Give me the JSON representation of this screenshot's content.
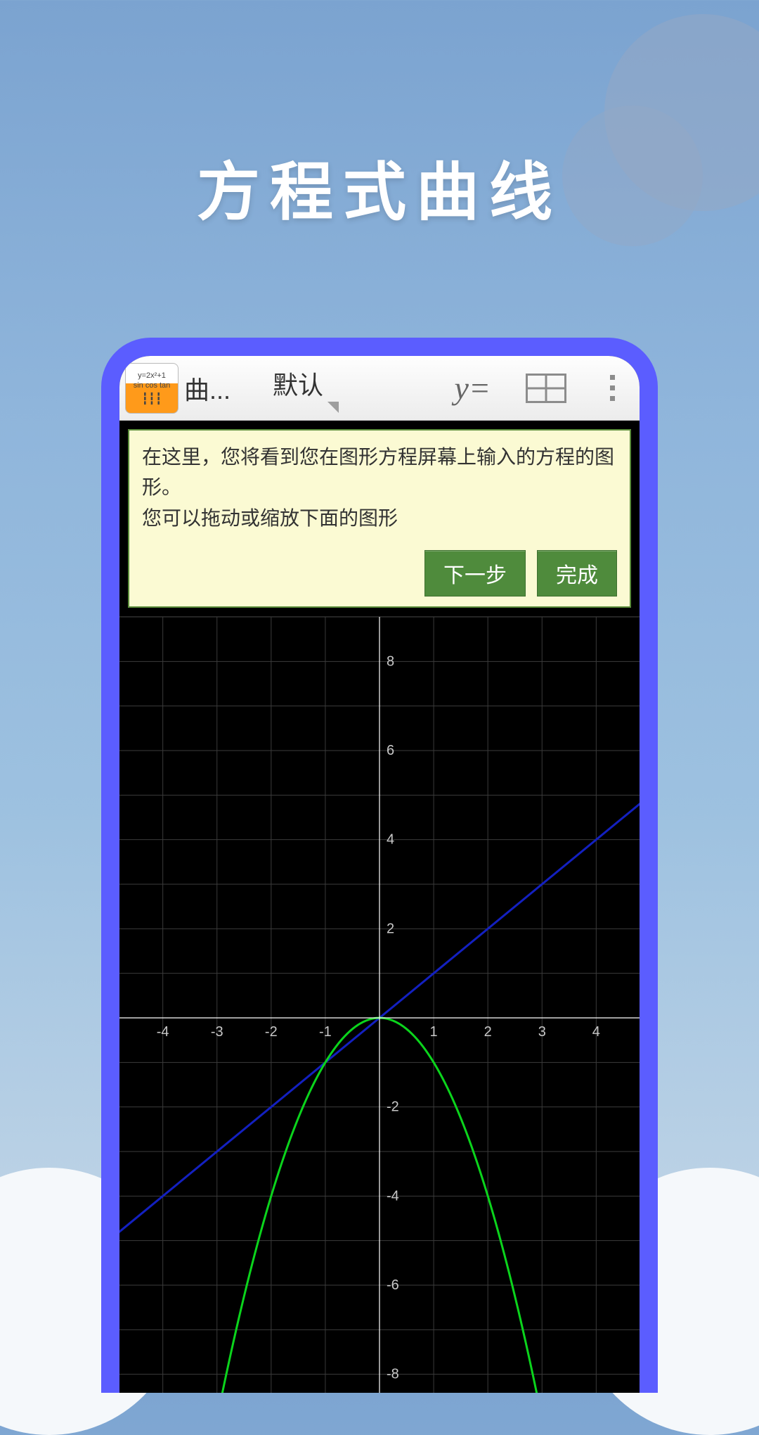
{
  "hero": {
    "title": "方程式曲线"
  },
  "toolbar": {
    "app_icon_top": "y=2x²+1",
    "app_icon_mid": "sin cos tan",
    "title": "曲...",
    "dropdown": "默认",
    "y_equals": "y=",
    "table_icon_name": "table-icon",
    "menu_icon_name": "kebab-menu-icon"
  },
  "hint": {
    "line1": "在这里，您将看到您在图形方程屏幕上输入的方程的图形。",
    "line2": "您可以拖动或缩放下面的图形",
    "next": "下一步",
    "done": "完成"
  },
  "chart_data": {
    "type": "line",
    "xlabel": "",
    "ylabel": "",
    "xlim": [
      -4.8,
      4.8
    ],
    "ylim": [
      -9,
      9
    ],
    "x_ticks": [
      -4,
      -3,
      -2,
      -1,
      1,
      2,
      3,
      4
    ],
    "y_ticks": [
      -8,
      -6,
      -4,
      -2,
      2,
      4,
      6,
      8
    ],
    "series": [
      {
        "name": "line",
        "color": "#1320c0",
        "formula": "y = x",
        "x": [
          -9,
          9
        ],
        "y": [
          -9,
          9
        ]
      },
      {
        "name": "parabola",
        "color": "#0bd41c",
        "formula": "y = -x^2",
        "x": [
          -3,
          -2.5,
          -2,
          -1.5,
          -1,
          -0.5,
          0,
          0.5,
          1,
          1.5,
          2,
          2.5,
          3
        ],
        "y": [
          -9,
          -6.25,
          -4,
          -2.25,
          -1,
          -0.25,
          0,
          -0.25,
          -1,
          -2.25,
          -4,
          -6.25,
          -9
        ]
      }
    ]
  }
}
